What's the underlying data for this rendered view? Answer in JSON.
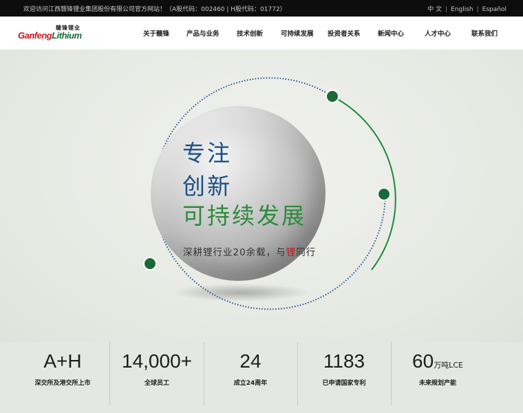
{
  "topbar": {
    "welcome": "欢迎访问江西赣锋锂业集团股份有限公司官方网站！（A股代码：002460 | H股代码：01772）",
    "languages": [
      "中 文",
      "English",
      "Español"
    ],
    "separator": "|"
  },
  "logo": {
    "cn": "赣锋锂业",
    "en_part1": "Ganfeng",
    "en_part2": "Lithium"
  },
  "nav": {
    "items": [
      "关于赣锋",
      "产品与业务",
      "技术创新",
      "可持续发展",
      "投资者关系",
      "新闻中心",
      "人才中心",
      "联系我们"
    ]
  },
  "hero": {
    "line1": "专注",
    "line2": "创新",
    "line3": "可持续发展",
    "tagline_before": "深耕锂行业20余载，与",
    "tagline_highlight": "锂",
    "tagline_after": "同行"
  },
  "stats": [
    {
      "value": "A+H",
      "unit": "",
      "label": "深交所及港交所上市"
    },
    {
      "value": "14,000+",
      "unit": "",
      "label": "全球员工"
    },
    {
      "value": "24",
      "unit": "",
      "label": "成立24周年"
    },
    {
      "value": "1183",
      "unit": "",
      "label": "已申请国家专利"
    },
    {
      "value": "60",
      "unit": "万吨LCE",
      "label": "未来规划产能"
    }
  ],
  "colors": {
    "brand_green": "#1a6b37",
    "brand_red": "#c8171e",
    "headline_blue": "#1d4f86",
    "headline_green": "#2d8a3e",
    "ring_blue": "#1c4f8c"
  }
}
